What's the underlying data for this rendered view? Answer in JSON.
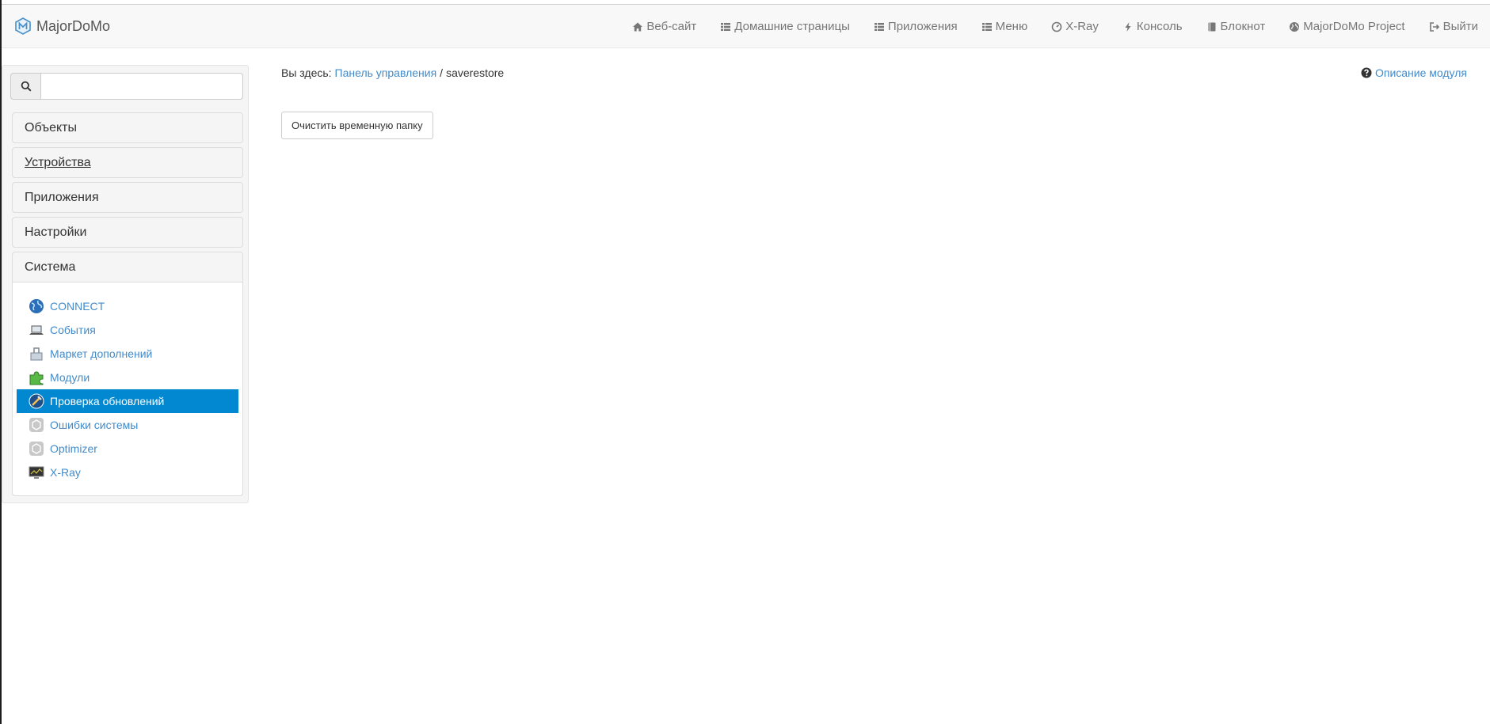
{
  "app": {
    "title": "MajorDoMo"
  },
  "navbar": {
    "items": [
      {
        "label": "Веб-сайт",
        "icon": "home-icon"
      },
      {
        "label": "Домашние страницы",
        "icon": "list-icon"
      },
      {
        "label": "Приложения",
        "icon": "list-icon"
      },
      {
        "label": "Меню",
        "icon": "list-icon"
      },
      {
        "label": "X-Ray",
        "icon": "dashboard-icon"
      },
      {
        "label": "Консоль",
        "icon": "bolt-icon"
      },
      {
        "label": "Блокнот",
        "icon": "book-icon"
      },
      {
        "label": "MajorDoMo Project",
        "icon": "globe-icon"
      },
      {
        "label": "Выйти",
        "icon": "logout-icon"
      }
    ]
  },
  "sidebar": {
    "search": {
      "value": "",
      "placeholder": ""
    },
    "sections": [
      {
        "label": "Объекты"
      },
      {
        "label": "Устройства"
      },
      {
        "label": "Приложения"
      },
      {
        "label": "Настройки"
      },
      {
        "label": "Система"
      }
    ],
    "system_items": [
      {
        "label": "CONNECT",
        "icon": "globe-icon"
      },
      {
        "label": "События",
        "icon": "laptop-icon"
      },
      {
        "label": "Маркет дополнений",
        "icon": "market-icon"
      },
      {
        "label": "Модули",
        "icon": "puzzle-icon"
      },
      {
        "label": "Проверка обновлений",
        "icon": "update-icon",
        "active": true
      },
      {
        "label": "Ошибки системы",
        "icon": "module-icon"
      },
      {
        "label": "Optimizer",
        "icon": "module-icon"
      },
      {
        "label": "X-Ray",
        "icon": "monitor-icon"
      }
    ]
  },
  "main": {
    "breadcrumb": {
      "prefix": "Вы здесь:",
      "link": "Панель управления",
      "separator": "/",
      "current": "saverestore"
    },
    "module_help": "Описание модуля",
    "clear_button": "Очистить временную папку"
  },
  "colors": {
    "accent": "#428bca",
    "active_bg": "#0288d1",
    "navbar_bg": "#f8f8f8"
  }
}
